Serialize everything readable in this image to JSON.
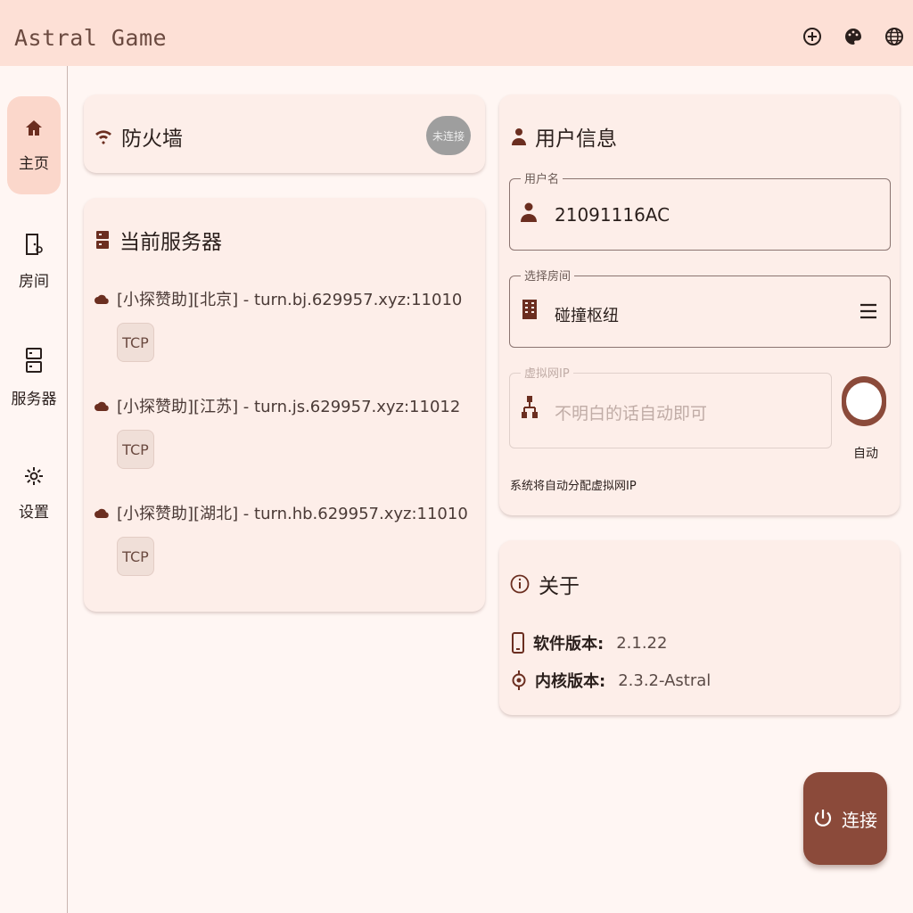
{
  "app": {
    "title": "Astral Game"
  },
  "topbar": {
    "icons": [
      "add-circle-icon",
      "palette-icon",
      "globe-icon"
    ]
  },
  "nav": [
    {
      "label": "主页",
      "icon": "home-icon"
    },
    {
      "label": "房间",
      "icon": "room-icon"
    },
    {
      "label": "服务器",
      "icon": "server-icon"
    },
    {
      "label": "设置",
      "icon": "gear-icon"
    }
  ],
  "firewall": {
    "title": "防火墙",
    "badge": "未连接"
  },
  "servers": {
    "title": "当前服务器",
    "items": [
      {
        "name": "[小探赞助][北京] - turn.bj.629957.xyz:11010",
        "protocol": "TCP"
      },
      {
        "name": "[小探赞助][江苏] - turn.js.629957.xyz:11012",
        "protocol": "TCP"
      },
      {
        "name": "[小探赞助][湖北] - turn.hb.629957.xyz:11010",
        "protocol": "TCP"
      }
    ]
  },
  "user": {
    "title": "用户信息",
    "username_label": "用户名",
    "username": "21091116AC",
    "room_label": "选择房间",
    "room": "碰撞枢纽",
    "ip_label": "虚拟网IP",
    "ip_placeholder": "不明白的话自动即可",
    "auto_label": "自动",
    "hint": "系统将自动分配虚拟网IP"
  },
  "about": {
    "title": "关于",
    "software_label": "软件版本:",
    "software_version": "2.1.22",
    "kernel_label": "内核版本:",
    "kernel_version": "2.3.2-Astral"
  },
  "connect": {
    "label": "连接"
  },
  "colors": {
    "accent": "#8b4a3a",
    "topbar": "#fde0d6",
    "card": "#fdeee9",
    "background": "#fff6f3"
  }
}
